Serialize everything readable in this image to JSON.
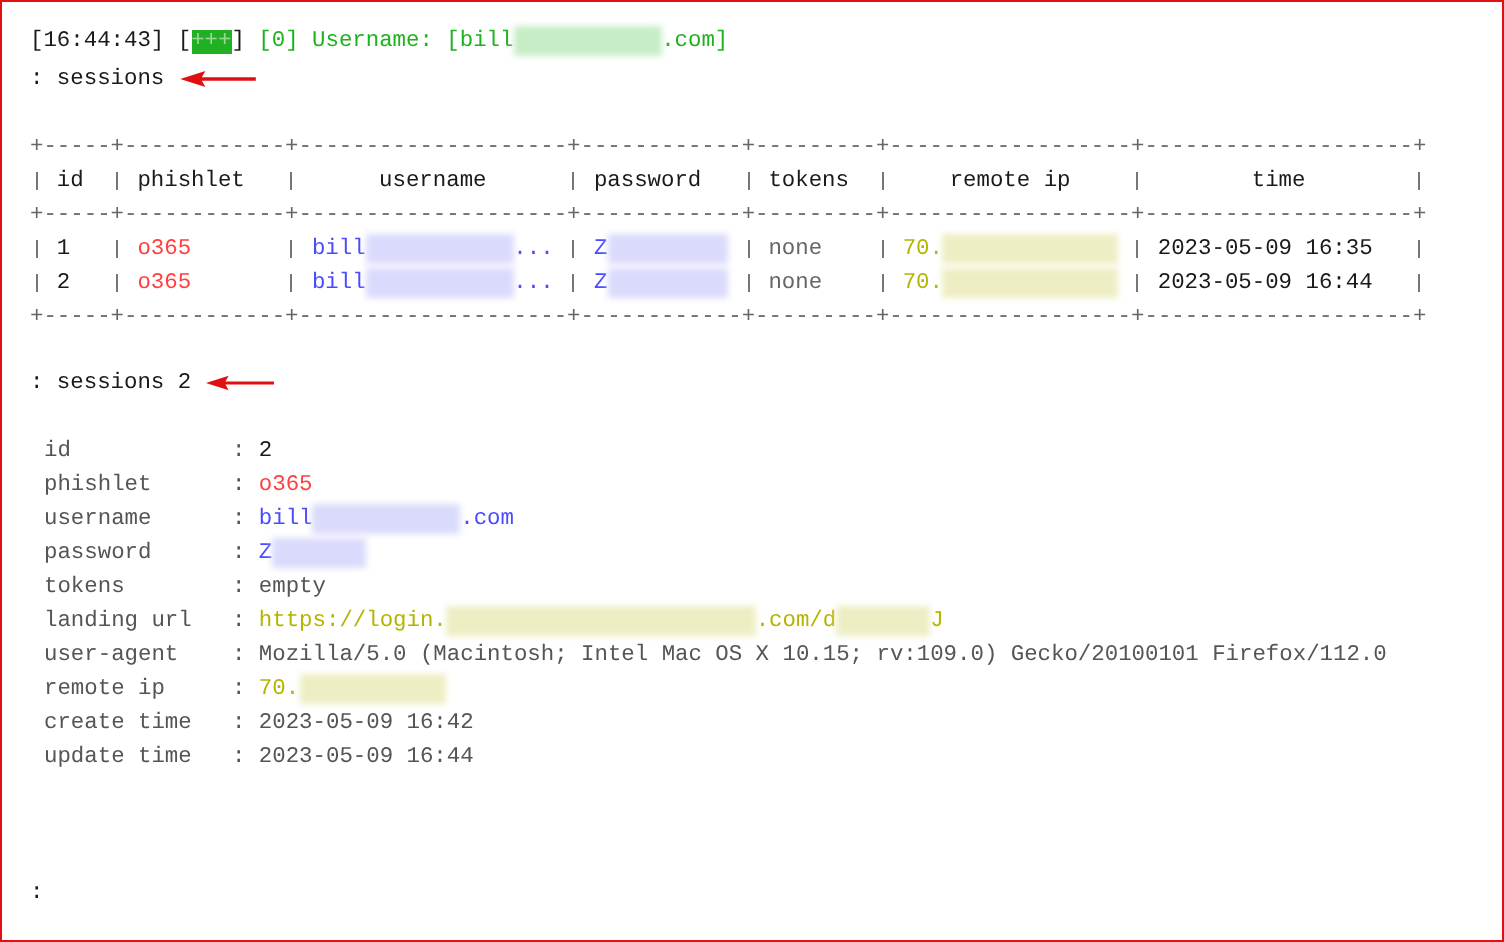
{
  "log_line": [
    {
      "kind": "text",
      "text": "[16:44:43] [",
      "color": "#1a1a1a"
    },
    {
      "kind": "badge",
      "text": "+++"
    },
    {
      "kind": "text",
      "text": "] ",
      "color": "#1a1a1a"
    },
    {
      "kind": "text",
      "text": "[0] Username: [bill",
      "color": "#1fb21f"
    },
    {
      "kind": "blur-medium",
      "color": "#c6edc6"
    },
    {
      "kind": "text",
      "text": ".com]",
      "color": "#1fb21f"
    }
  ],
  "command_1": {
    "text": ": sessions",
    "annotated": true
  },
  "table": {
    "rules": [
      "+-----+------------+--------------------+------------+---------+------------------+--------------------+",
      "+-----+------------+--------------------+------------+---------+------------------+--------------------+",
      "+-----+------------+--------------------+------------+---------+------------------+--------------------+"
    ],
    "columns": [
      "id",
      "phishlet",
      "username",
      "password",
      "tokens",
      "remote ip",
      "time"
    ],
    "rows": [
      {
        "cells": [
          [
            {
              "kind": "text",
              "text": "1",
              "color": "#1a1a1a"
            }
          ],
          [
            {
              "kind": "text",
              "text": "o365",
              "color": "#ff4040"
            }
          ],
          [
            {
              "kind": "text",
              "text": "bill",
              "color": "#4a4aff"
            },
            {
              "kind": "blur-fill",
              "color": "#dadafc"
            },
            {
              "kind": "text",
              "text": "...",
              "color": "#4a4aff"
            }
          ],
          [
            {
              "kind": "text",
              "text": "Z",
              "color": "#4a4aff"
            },
            {
              "kind": "blur-fill",
              "color": "#dadafc"
            }
          ],
          [
            {
              "kind": "text",
              "text": "none",
              "color": "#666666"
            }
          ],
          [
            {
              "kind": "text",
              "text": "70.",
              "color": "#b5b500"
            },
            {
              "kind": "blur-fill",
              "color": "#eeeec4"
            }
          ],
          [
            {
              "kind": "text",
              "text": "2023-05-09 16:35",
              "color": "#1a1a1a"
            }
          ]
        ]
      },
      {
        "cells": [
          [
            {
              "kind": "text",
              "text": "2",
              "color": "#1a1a1a"
            }
          ],
          [
            {
              "kind": "text",
              "text": "o365",
              "color": "#ff4040"
            }
          ],
          [
            {
              "kind": "text",
              "text": "bill",
              "color": "#4a4aff"
            },
            {
              "kind": "blur-fill",
              "color": "#dadafc"
            },
            {
              "kind": "text",
              "text": "...",
              "color": "#4a4aff"
            }
          ],
          [
            {
              "kind": "text",
              "text": "Z",
              "color": "#4a4aff"
            },
            {
              "kind": "blur-fill",
              "color": "#dadafc"
            }
          ],
          [
            {
              "kind": "text",
              "text": "none",
              "color": "#666666"
            }
          ],
          [
            {
              "kind": "text",
              "text": "70.",
              "color": "#b5b500"
            },
            {
              "kind": "blur-fill",
              "color": "#eeeec4"
            }
          ],
          [
            {
              "kind": "text",
              "text": "2023-05-09 16:44",
              "color": "#1a1a1a"
            }
          ]
        ]
      }
    ]
  },
  "command_2": {
    "text": ": sessions 2",
    "annotated": true
  },
  "details": [
    {
      "label": "id",
      "separator": ":",
      "value": [
        {
          "kind": "text",
          "text": "2",
          "color": "#1a1a1a"
        }
      ]
    },
    {
      "label": "phishlet",
      "separator": ":",
      "value": [
        {
          "kind": "text",
          "text": "o365",
          "color": "#ff4040"
        }
      ]
    },
    {
      "label": "username",
      "separator": ":",
      "value": [
        {
          "kind": "text",
          "text": "bill",
          "color": "#4a4aff"
        },
        {
          "kind": "blur-medium",
          "color": "#dadafc"
        },
        {
          "kind": "text",
          "text": ".com",
          "color": "#4a4aff"
        }
      ]
    },
    {
      "label": "password",
      "separator": ":",
      "value": [
        {
          "kind": "text",
          "text": "Z",
          "color": "#4a4aff"
        },
        {
          "kind": "blur-short",
          "color": "#dadafc"
        }
      ]
    },
    {
      "label": "tokens",
      "separator": ":",
      "value": [
        {
          "kind": "text",
          "text": "empty",
          "color": "#555555"
        }
      ]
    },
    {
      "label": "landing url",
      "separator": ":",
      "value": [
        {
          "kind": "text",
          "text": "https://login.",
          "color": "#b5b500"
        },
        {
          "kind": "blur-long",
          "color": "#eeeec4"
        },
        {
          "kind": "text",
          "text": ".com/d",
          "color": "#b5b500"
        },
        {
          "kind": "blur-short",
          "color": "#eeeec4"
        },
        {
          "kind": "text",
          "text": "J",
          "color": "#b5b500"
        }
      ]
    },
    {
      "label": "user-agent",
      "separator": ":",
      "value": [
        {
          "kind": "text",
          "text": "Mozilla/5.0 (Macintosh; Intel Mac OS X 10.15; rv:109.0) Gecko/20100101 Firefox/112.0",
          "color": "#555555"
        }
      ]
    },
    {
      "label": "remote ip",
      "separator": ":",
      "value": [
        {
          "kind": "text",
          "text": "70.",
          "color": "#b5b500"
        },
        {
          "kind": "blur-medium",
          "color": "#eeeec4"
        }
      ]
    },
    {
      "label": "create time",
      "separator": ":",
      "value": [
        {
          "kind": "text",
          "text": "2023-05-09 16:42",
          "color": "#555555"
        }
      ]
    },
    {
      "label": "update time",
      "separator": ":",
      "value": [
        {
          "kind": "text",
          "text": "2023-05-09 16:44",
          "color": "#555555"
        }
      ]
    }
  ],
  "prompt": ":"
}
